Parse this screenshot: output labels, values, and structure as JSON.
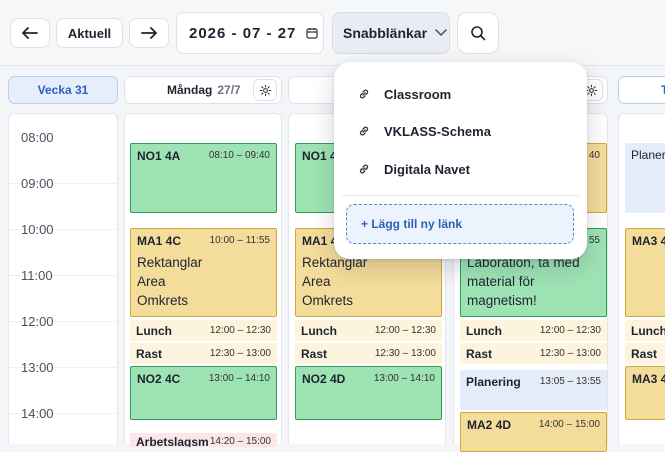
{
  "toolbar": {
    "back_icon": "arrow-left-icon",
    "current_label": "Aktuell",
    "forward_icon": "arrow-right-icon",
    "date_value": "2026 - 07 - 27",
    "calendar_icon": "calendar-icon",
    "quicklinks_label": "Snabblänkar",
    "search_icon": "search-icon"
  },
  "calendar": {
    "week_label": "Vecka 31",
    "days": [
      {
        "name": "Måndag",
        "date": "27/7"
      }
    ],
    "times": [
      "08:00",
      "09:00",
      "10:00",
      "11:00",
      "12:00",
      "13:00",
      "14:00"
    ],
    "monday_events": [
      {
        "title": "NO1 4A",
        "time": "08:10 – 09:40"
      },
      {
        "title": "MA1 4C",
        "time": "10:00 – 11:55",
        "desc": [
          "Rektanglar",
          "Area",
          "Omkrets"
        ]
      },
      {
        "title": "Lunch",
        "time": "12:00 – 12:30"
      },
      {
        "title": "Rast",
        "time": "12:30 – 13:00"
      },
      {
        "title": "NO2 4C",
        "time": "13:00 – 14:10"
      },
      {
        "title": "Arbetslagsm",
        "time": "14:20 – 15:00"
      }
    ],
    "tuesday_events": [
      {
        "title": "NO1 4",
        "time": ""
      },
      {
        "title": "MA1 4",
        "desc": [
          "Rektanglar",
          "Area",
          "Omkrets"
        ]
      },
      {
        "title": "Lunch",
        "time": "12:00 – 12:30"
      },
      {
        "title": "Rast",
        "time": "12:30 – 13:00"
      },
      {
        "title": "NO2 4D",
        "time": "13:00 – 14:10"
      }
    ],
    "wednesday_events": [
      {
        "time_top": "40"
      },
      {
        "time_top": "55",
        "desc": [
          "Laboration, ta med",
          "material för",
          "magnetism!"
        ]
      },
      {
        "title": "Lunch",
        "time": "12:00 – 12:30"
      },
      {
        "title": "Rast",
        "time": "12:30 – 13:00"
      },
      {
        "title": "Planering",
        "time": "13:05 – 13:55"
      },
      {
        "title": "MA2 4D",
        "time": "14:00 – 15:00"
      }
    ],
    "thursday_events": [
      {
        "title": "Planer"
      },
      {
        "title": "MA3 4"
      },
      {
        "title": "Lunch"
      },
      {
        "title": "Rast"
      },
      {
        "title": "MA3 4"
      }
    ]
  },
  "quicklinks": {
    "link_icon": "link-icon",
    "items": [
      "Classroom",
      "VKLASS-Schema",
      "Digitala Navet"
    ],
    "add_label": "+ Lägg till ny länk"
  },
  "colors": {
    "lesson_green": "#9ee3b4",
    "lesson_yellow": "#f4dc9a",
    "break_cream": "#fcf4dc",
    "planning_blue": "#e4ecfa",
    "accent_blue": "#2b5fb8"
  }
}
